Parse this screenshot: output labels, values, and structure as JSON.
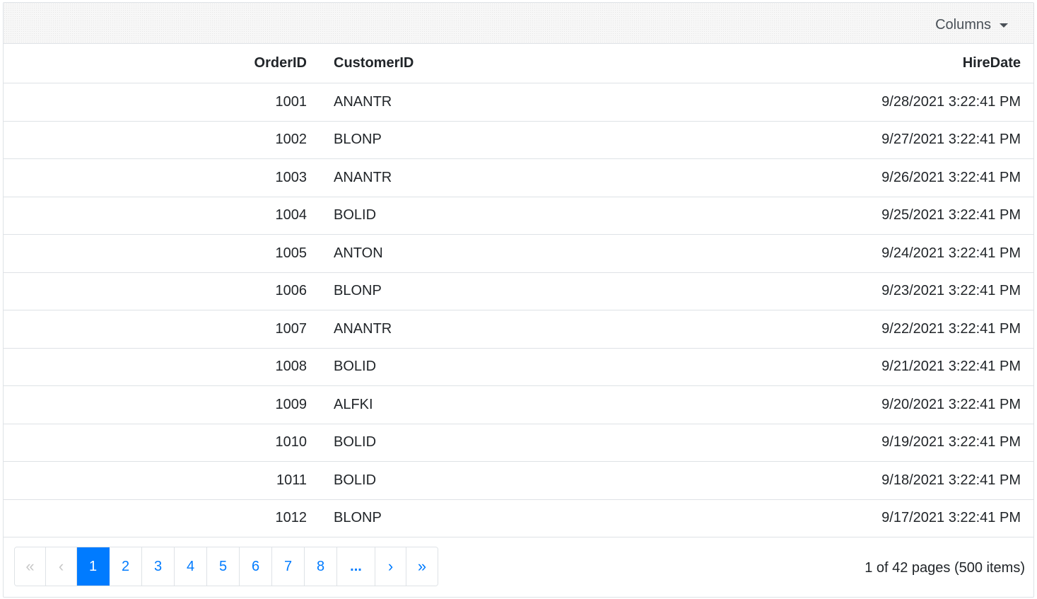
{
  "toolbar": {
    "columns_label": "Columns",
    "columns_icon": "caret-down-icon"
  },
  "columns": {
    "order_id": "OrderID",
    "customer_id": "CustomerID",
    "hire_date": "HireDate"
  },
  "rows": [
    {
      "order_id": "1001",
      "customer_id": "ANANTR",
      "hire_date": "9/28/2021 3:22:41 PM"
    },
    {
      "order_id": "1002",
      "customer_id": "BLONP",
      "hire_date": "9/27/2021 3:22:41 PM"
    },
    {
      "order_id": "1003",
      "customer_id": "ANANTR",
      "hire_date": "9/26/2021 3:22:41 PM"
    },
    {
      "order_id": "1004",
      "customer_id": "BOLID",
      "hire_date": "9/25/2021 3:22:41 PM"
    },
    {
      "order_id": "1005",
      "customer_id": "ANTON",
      "hire_date": "9/24/2021 3:22:41 PM"
    },
    {
      "order_id": "1006",
      "customer_id": "BLONP",
      "hire_date": "9/23/2021 3:22:41 PM"
    },
    {
      "order_id": "1007",
      "customer_id": "ANANTR",
      "hire_date": "9/22/2021 3:22:41 PM"
    },
    {
      "order_id": "1008",
      "customer_id": "BOLID",
      "hire_date": "9/21/2021 3:22:41 PM"
    },
    {
      "order_id": "1009",
      "customer_id": "ALFKI",
      "hire_date": "9/20/2021 3:22:41 PM"
    },
    {
      "order_id": "1010",
      "customer_id": "BOLID",
      "hire_date": "9/19/2021 3:22:41 PM"
    },
    {
      "order_id": "1011",
      "customer_id": "BOLID",
      "hire_date": "9/18/2021 3:22:41 PM"
    },
    {
      "order_id": "1012",
      "customer_id": "BLONP",
      "hire_date": "9/17/2021 3:22:41 PM"
    }
  ],
  "pager": {
    "first_label": "«",
    "prev_label": "‹",
    "pages": [
      "1",
      "2",
      "3",
      "4",
      "5",
      "6",
      "7",
      "8"
    ],
    "active_page": "1",
    "ellipsis_label": "...",
    "next_label": "›",
    "last_label": "»",
    "info": "1 of 42 pages (500 items)"
  },
  "colors": {
    "accent": "#007bff",
    "border": "#dee2e6",
    "disabled": "#c8c8c8"
  }
}
